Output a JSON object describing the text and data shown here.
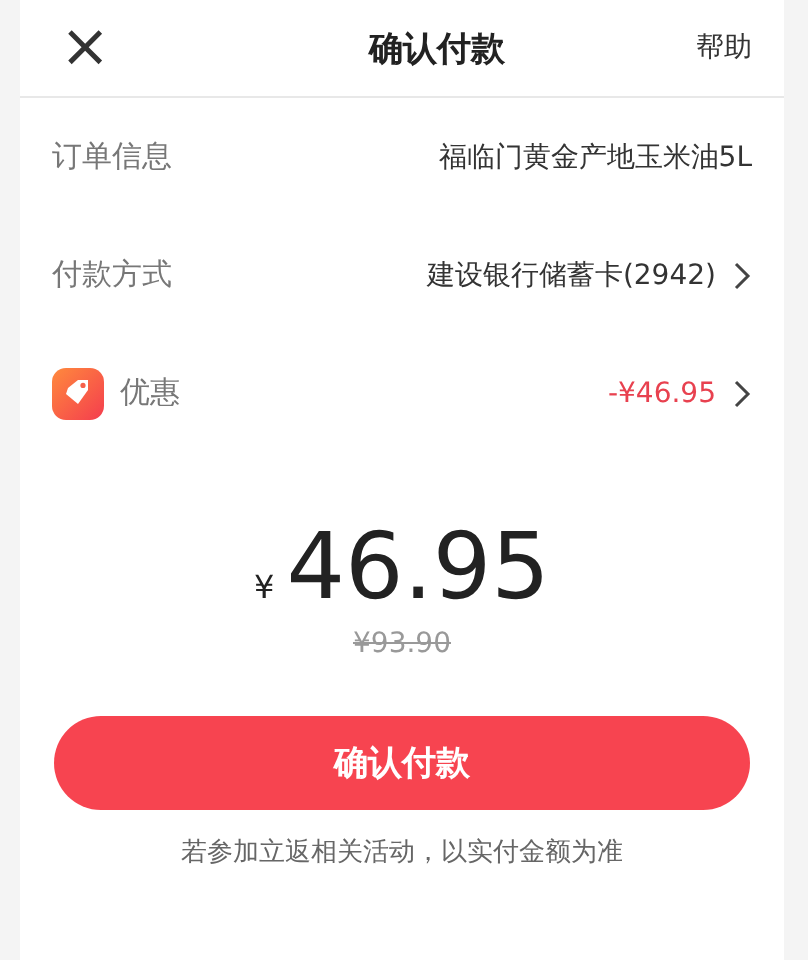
{
  "header": {
    "close": "×",
    "title": "确认付款",
    "help": "帮助"
  },
  "rows": [
    {
      "kind": "plain",
      "label": "订单信息",
      "value": "福临门黄金产地玉米油5L",
      "chevron": false
    },
    {
      "kind": "plain",
      "label": "付款方式",
      "value": "建设银行储蓄卡(2942)",
      "chevron": true
    },
    {
      "kind": "discount",
      "label": "优惠",
      "value": "-¥46.95",
      "chevron": true
    }
  ],
  "amount": {
    "currency": "¥",
    "value": "46.95",
    "original": "¥93.90"
  },
  "confirm_button": "确认付款",
  "note": "若参加立返相关活动，以实付金额为准"
}
